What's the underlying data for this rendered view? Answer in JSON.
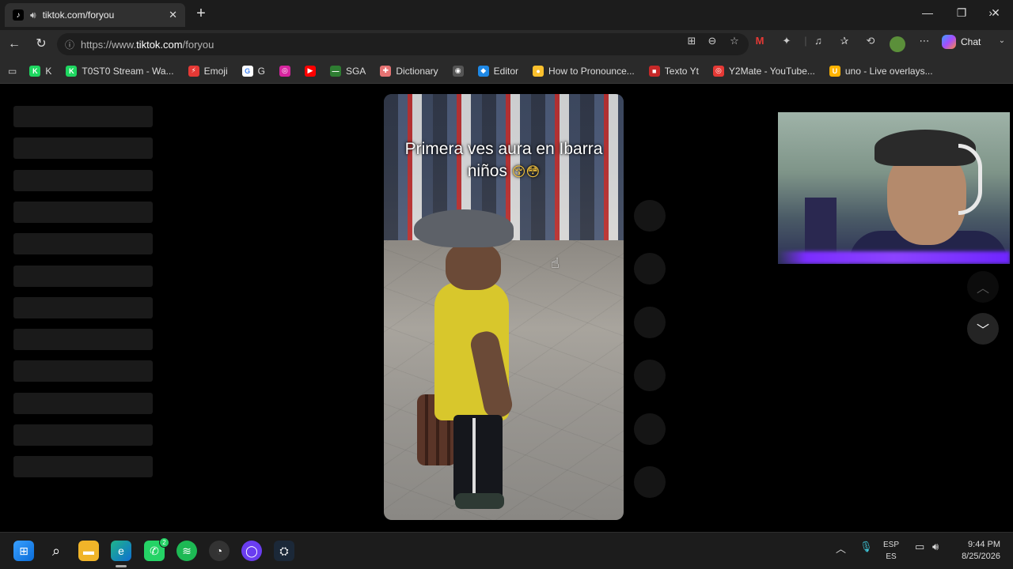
{
  "tab": {
    "title": "tiktok.com/foryou"
  },
  "address": {
    "protocol": "https://www.",
    "host": "tiktok.com",
    "path": "/foryou"
  },
  "toolbar": {
    "chat_label": "Chat"
  },
  "bookmarks": [
    {
      "label": "K",
      "color": "#1ed760",
      "glyph": "K"
    },
    {
      "label": "T0ST0 Stream - Wa...",
      "color": "#1ed760",
      "glyph": "K"
    },
    {
      "label": "Emoji",
      "color": "#e53935",
      "glyph": "⚡"
    },
    {
      "label": "G",
      "color": "#ffffff",
      "glyph": "G"
    },
    {
      "label": "",
      "color": "#d6249f",
      "glyph": "◎"
    },
    {
      "label": "",
      "color": "#ff0000",
      "glyph": "▶"
    },
    {
      "label": "SGA",
      "color": "#2e7d32",
      "glyph": "—"
    },
    {
      "label": "Dictionary",
      "color": "#e57373",
      "glyph": "✚"
    },
    {
      "label": "",
      "color": "#555555",
      "glyph": "◉"
    },
    {
      "label": "Editor",
      "color": "#1e88e5",
      "glyph": "◆"
    },
    {
      "label": "How to Pronounce...",
      "color": "#fbc02d",
      "glyph": "●"
    },
    {
      "label": "Texto Yt",
      "color": "#c62828",
      "glyph": "■"
    },
    {
      "label": "Y2Mate - YouTube...",
      "color": "#e53935",
      "glyph": "◎"
    },
    {
      "label": "uno - Live overlays...",
      "color": "#ffb300",
      "glyph": "U"
    }
  ],
  "video": {
    "caption_line1": "Primera ves aura en Ibarra",
    "caption_line2": "niños",
    "caption_emoji": "😚😳"
  },
  "taskbar": {
    "whatsapp_badge": "2",
    "lang_top": "ESP",
    "lang_bottom": "ES",
    "time": "9:44 PM",
    "date": "8/25/2026"
  },
  "icons": {
    "tab_favicon": "tiktok-icon",
    "back": "back-arrow-icon",
    "reload": "reload-icon",
    "scroll_up": "chevron-up-icon",
    "scroll_down": "chevron-down-icon"
  }
}
